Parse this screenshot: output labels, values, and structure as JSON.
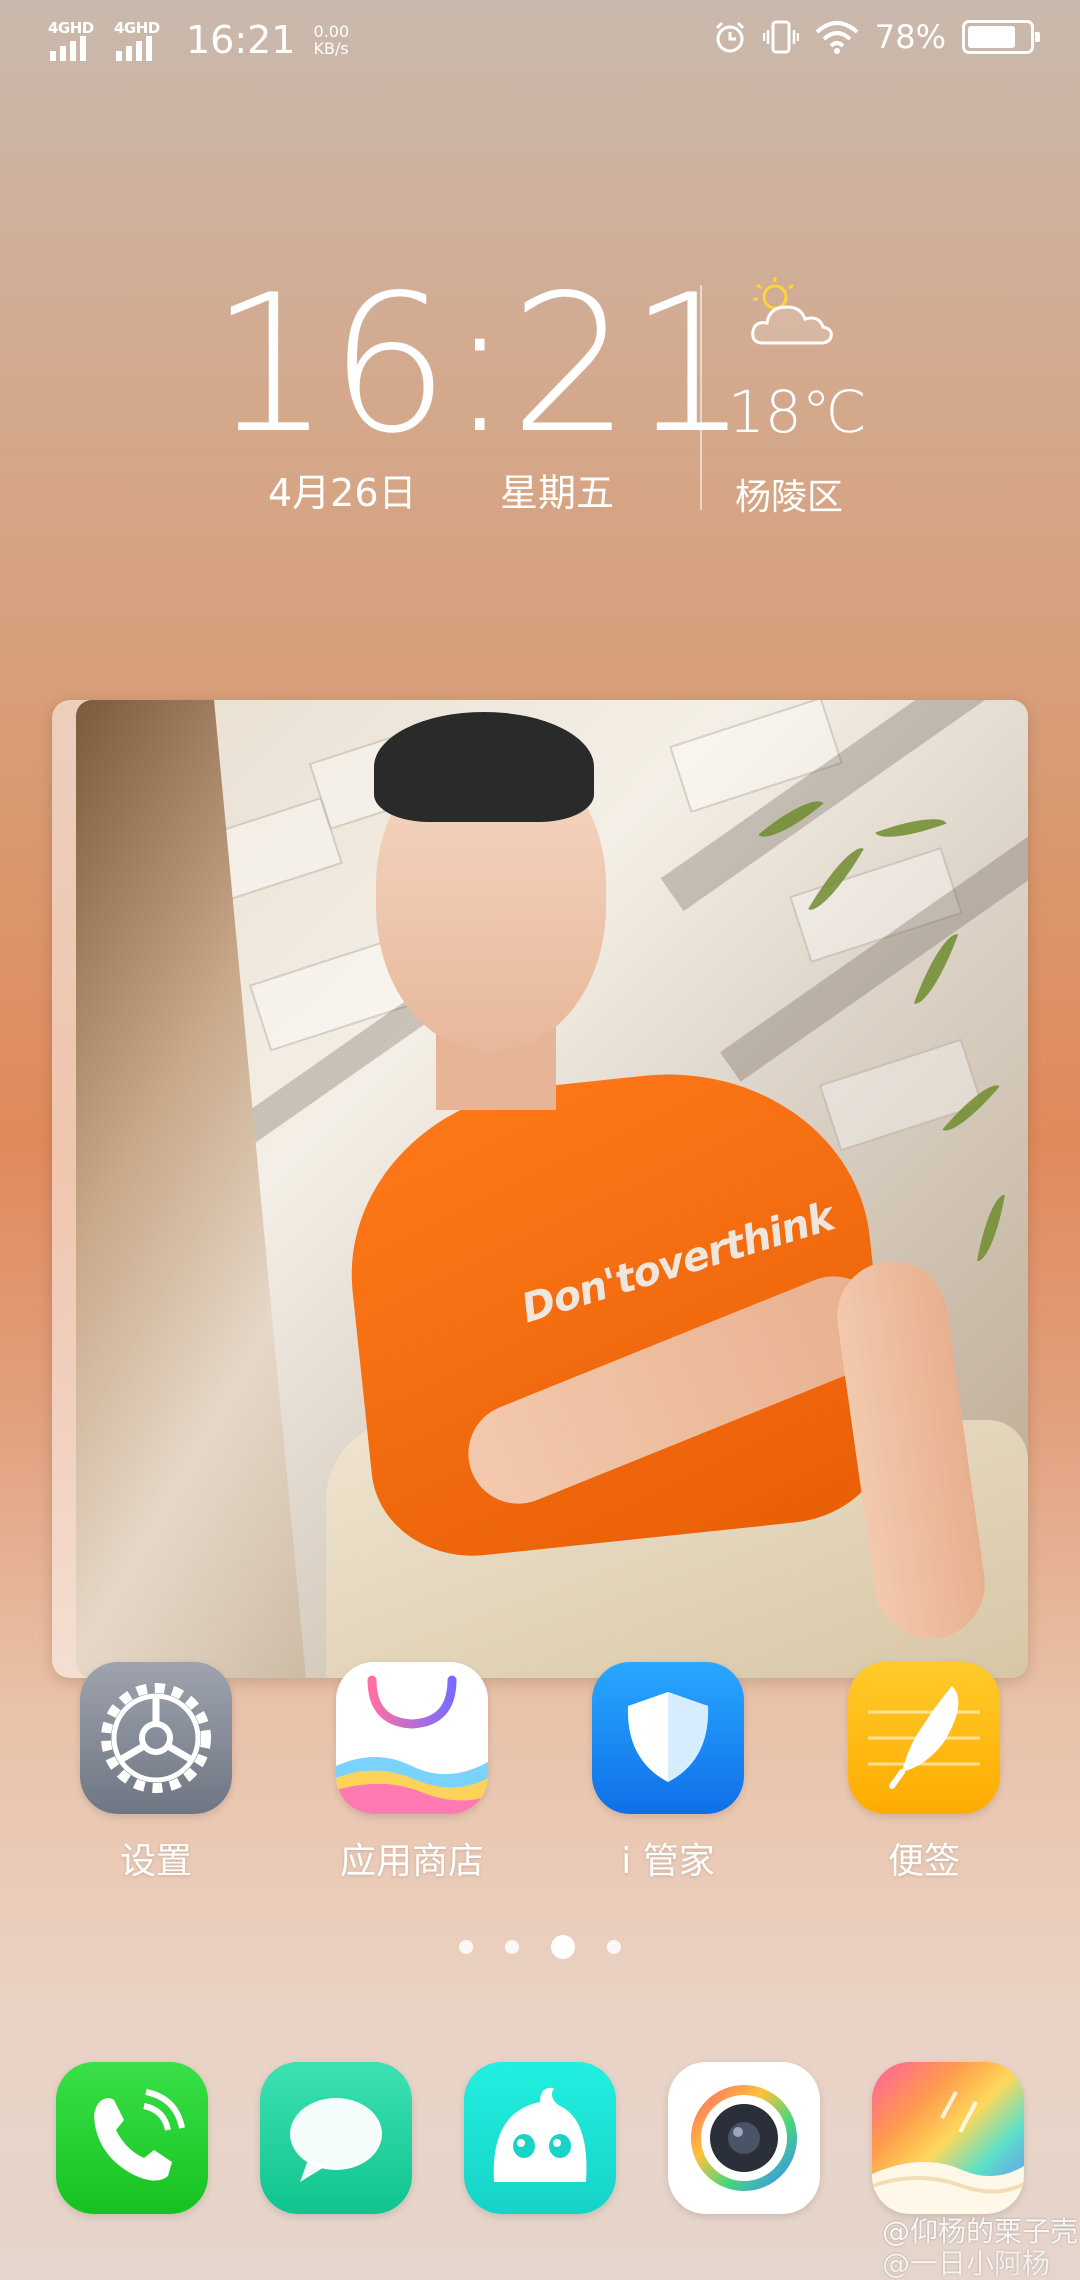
{
  "status_bar": {
    "net1": "4GHD",
    "net2": "4GHD",
    "time": "16:21",
    "speed_value": "0.00",
    "speed_unit": "KB/s",
    "battery_percent": "78%",
    "battery_level": 0.78
  },
  "clock_widget": {
    "time": "16:21",
    "date": "4月26日",
    "weekday": "星期五",
    "temperature": "18℃",
    "location": "杨陵区",
    "weather_icon": "partly-sunny-icon"
  },
  "photo_widget": {
    "shirt_text": "Don'toverthink"
  },
  "apps": [
    {
      "label": "设置",
      "icon": "gear-icon"
    },
    {
      "label": "应用商店",
      "icon": "store-bag-icon"
    },
    {
      "label": "i 管家",
      "icon": "shield-icon"
    },
    {
      "label": "便签",
      "icon": "feather-icon"
    }
  ],
  "page_indicator": {
    "count": 4,
    "active_index": 2
  },
  "dock": [
    {
      "icon": "phone-icon"
    },
    {
      "icon": "message-icon"
    },
    {
      "icon": "jovi-icon"
    },
    {
      "icon": "camera-icon"
    },
    {
      "icon": "gallery-icon"
    }
  ],
  "watermark": {
    "line1": "@仰杨的栗子壳",
    "line2": "@一日小阿杨"
  },
  "colors": {
    "orange_shirt": "#ff7a1a",
    "settings_gray": "#7f8694",
    "guard_blue": "#1a86f2",
    "notes_yellow": "#ffb800",
    "phone_green": "#22cc2e"
  }
}
